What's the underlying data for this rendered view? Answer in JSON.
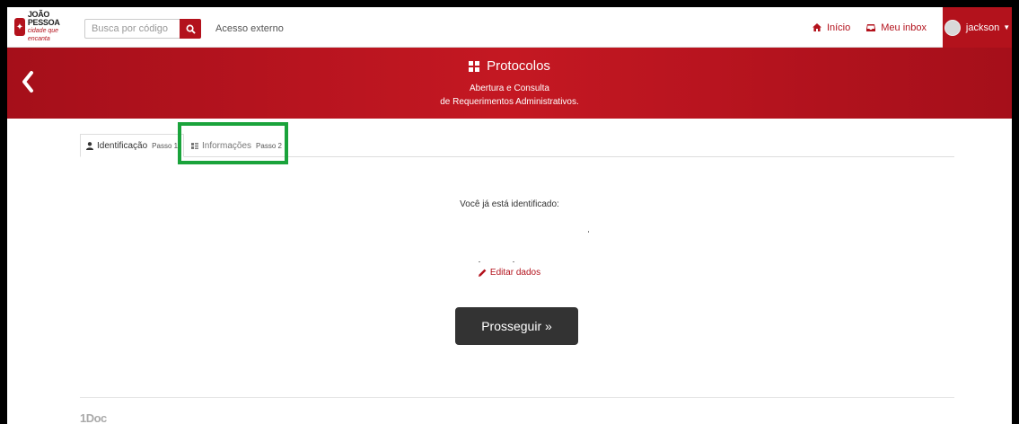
{
  "navbar": {
    "logo": {
      "line1": "JOÃO",
      "line2": "PESSOA",
      "tagline": "cidade que encanta"
    },
    "search": {
      "placeholder": "Busca por código"
    },
    "external_access_label": "Acesso externo",
    "home_label": "Início",
    "inbox_label": "Meu inbox",
    "user_label": "jackson"
  },
  "banner": {
    "title": "Protocolos",
    "subtitle_line1": "Abertura e Consulta",
    "subtitle_line2": "de Requerimentos Administrativos."
  },
  "tabs": [
    {
      "label": "Identificação",
      "step": "Passo 1",
      "active": true
    },
    {
      "label": "Informações",
      "step": "Passo 2",
      "active": false
    }
  ],
  "content": {
    "identified_text": "Você já está identificado:",
    "edit_label": "Editar dados",
    "proceed_label": "Prosseguir »"
  },
  "footer": {
    "brand": "1Doc"
  },
  "colors": {
    "brand": "#b3121c",
    "highlight": "#1aa33b",
    "button_dark": "#333333"
  }
}
